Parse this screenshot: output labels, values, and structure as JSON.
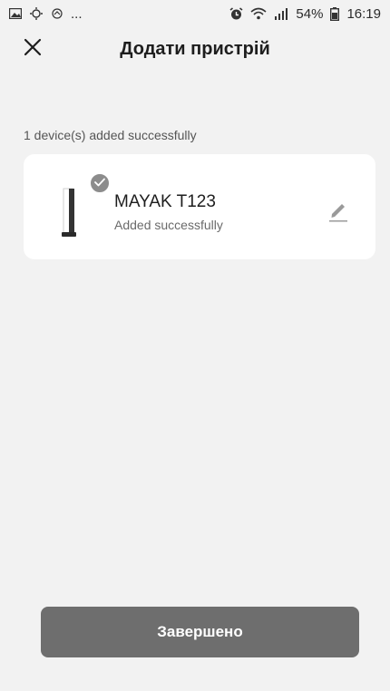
{
  "status_bar": {
    "left_icons": [
      "image-icon",
      "sync-icon",
      "cloud-icon"
    ],
    "ellipsis": "...",
    "right_icons": [
      "alarm-icon",
      "wifi-icon",
      "signal-icon",
      "battery-icon"
    ],
    "battery_percent": "54%",
    "time": "16:19"
  },
  "header": {
    "title": "Додати пристрій",
    "close_icon": "close-icon"
  },
  "summary": {
    "text": "1 device(s) added successfully"
  },
  "device": {
    "name": "MAYAK T123",
    "status": "Added successfully",
    "badge_icon": "check-icon",
    "edit_icon": "pencil-icon"
  },
  "footer": {
    "finish_label": "Завершено"
  },
  "colors": {
    "background": "#f2f2f2",
    "card": "#ffffff",
    "button": "#6e6e6e",
    "badge": "#8c8c8c"
  }
}
